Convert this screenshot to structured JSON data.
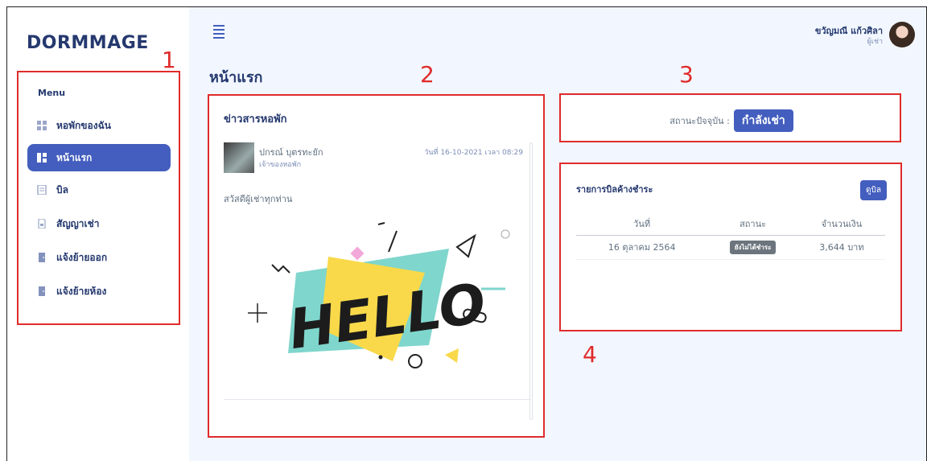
{
  "brand": "DORMMAGE",
  "sidebar": {
    "menu_title": "Menu",
    "items": [
      {
        "label": "หอพักของฉัน",
        "icon": "grid-icon"
      },
      {
        "label": "หน้าแรก",
        "icon": "dashboard-icon",
        "active": true
      },
      {
        "label": "บิล",
        "icon": "receipt-icon"
      },
      {
        "label": "สัญญาเช่า",
        "icon": "document-icon"
      },
      {
        "label": "แจ้งย้ายออก",
        "icon": "door-icon"
      },
      {
        "label": "แจ้งย้ายห้อง",
        "icon": "door-icon"
      }
    ]
  },
  "header": {
    "user_name": "ขวัญมณี แก้วศิลา",
    "user_role": "ผู้เช่า"
  },
  "page_title": "หน้าแรก",
  "news": {
    "title": "ข่าวสารหอพัก",
    "author": "ปกรณ์ บุตรทะยัก",
    "author_role": "เจ้าของหอพัก",
    "date": "วันที่ 16-10-2021 เวลา 08:29",
    "message": "สวัสดีผู้เช่าทุกท่าน",
    "image_text": "HELLO"
  },
  "status": {
    "label": "สถานะปัจจุบัน :",
    "value": "กำลังเช่า"
  },
  "bills": {
    "title": "รายการบิลค้างชำระ",
    "view_button": "ดูบิล",
    "columns": [
      "วันที่",
      "สถานะ",
      "จำนวนเงิน"
    ],
    "rows": [
      {
        "date": "16 ตุลาคม 2564",
        "status": "ยังไม่ได้ชำระ",
        "amount": "3,644 บาท"
      }
    ]
  },
  "annotations": [
    "1",
    "2",
    "3",
    "4"
  ],
  "colors": {
    "accent": "#435ebe",
    "annotation": "#e02b2b",
    "background": "#f2f7ff"
  }
}
